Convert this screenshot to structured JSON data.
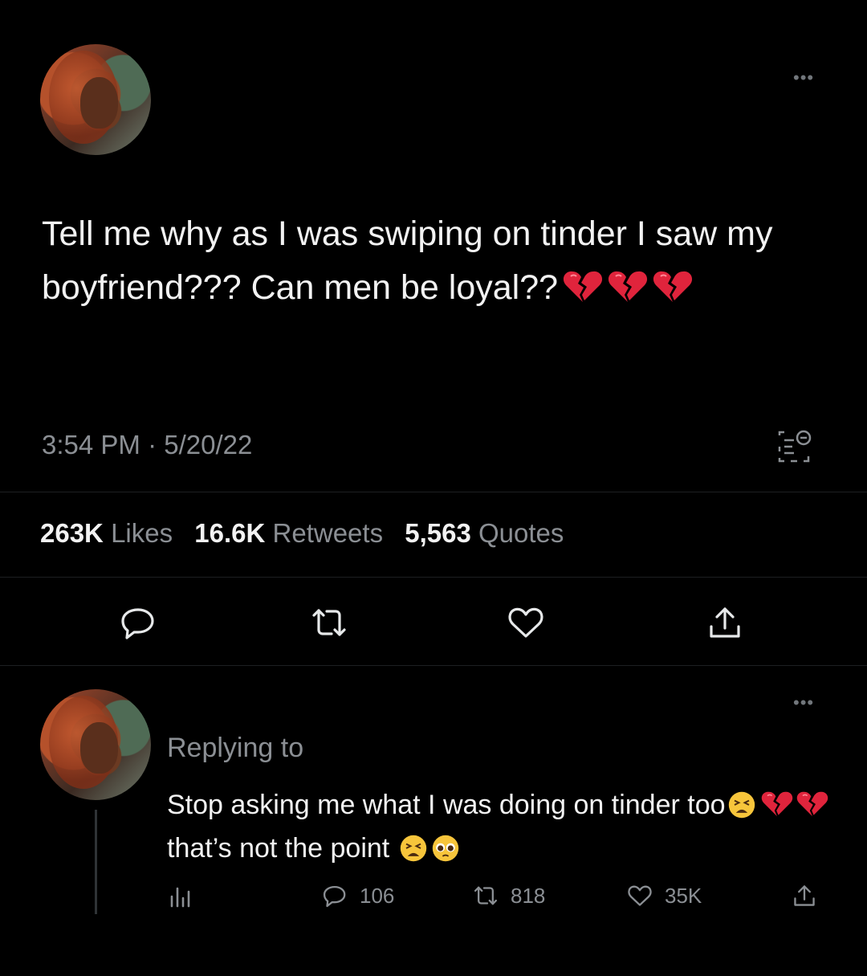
{
  "tweet": {
    "text": "Tell me why as I was swiping on tinder I saw my boyfriend??? Can men be loyal??",
    "emojis_after_text": [
      "broken-heart",
      "broken-heart",
      "broken-heart"
    ],
    "time": "3:54 PM",
    "separator": "·",
    "date": "5/20/22",
    "stats": {
      "likes_count": "263K",
      "likes_label": "Likes",
      "retweets_count": "16.6K",
      "retweets_label": "Retweets",
      "quotes_count": "5,563",
      "quotes_label": "Quotes"
    },
    "actions": [
      "reply-icon",
      "retweet-icon",
      "like-icon",
      "share-icon"
    ]
  },
  "reply": {
    "replying_to": "Replying to",
    "text_part1": "Stop asking me what I was doing on tinder too",
    "text_part2": "that’s not the point",
    "emojis_mid": [
      "tired-face",
      "broken-heart",
      "broken-heart"
    ],
    "emojis_end": [
      "tired-face",
      "pleading-face"
    ],
    "replies": "106",
    "retweets": "818",
    "likes": "35K",
    "actions": [
      "analytics-icon",
      "reply-icon",
      "retweet-icon",
      "like-icon",
      "share-icon"
    ]
  },
  "colors": {
    "background": "#000000",
    "text": "#f2f2f2",
    "muted": "#8b8f94",
    "broken_heart": "#e0243c"
  }
}
